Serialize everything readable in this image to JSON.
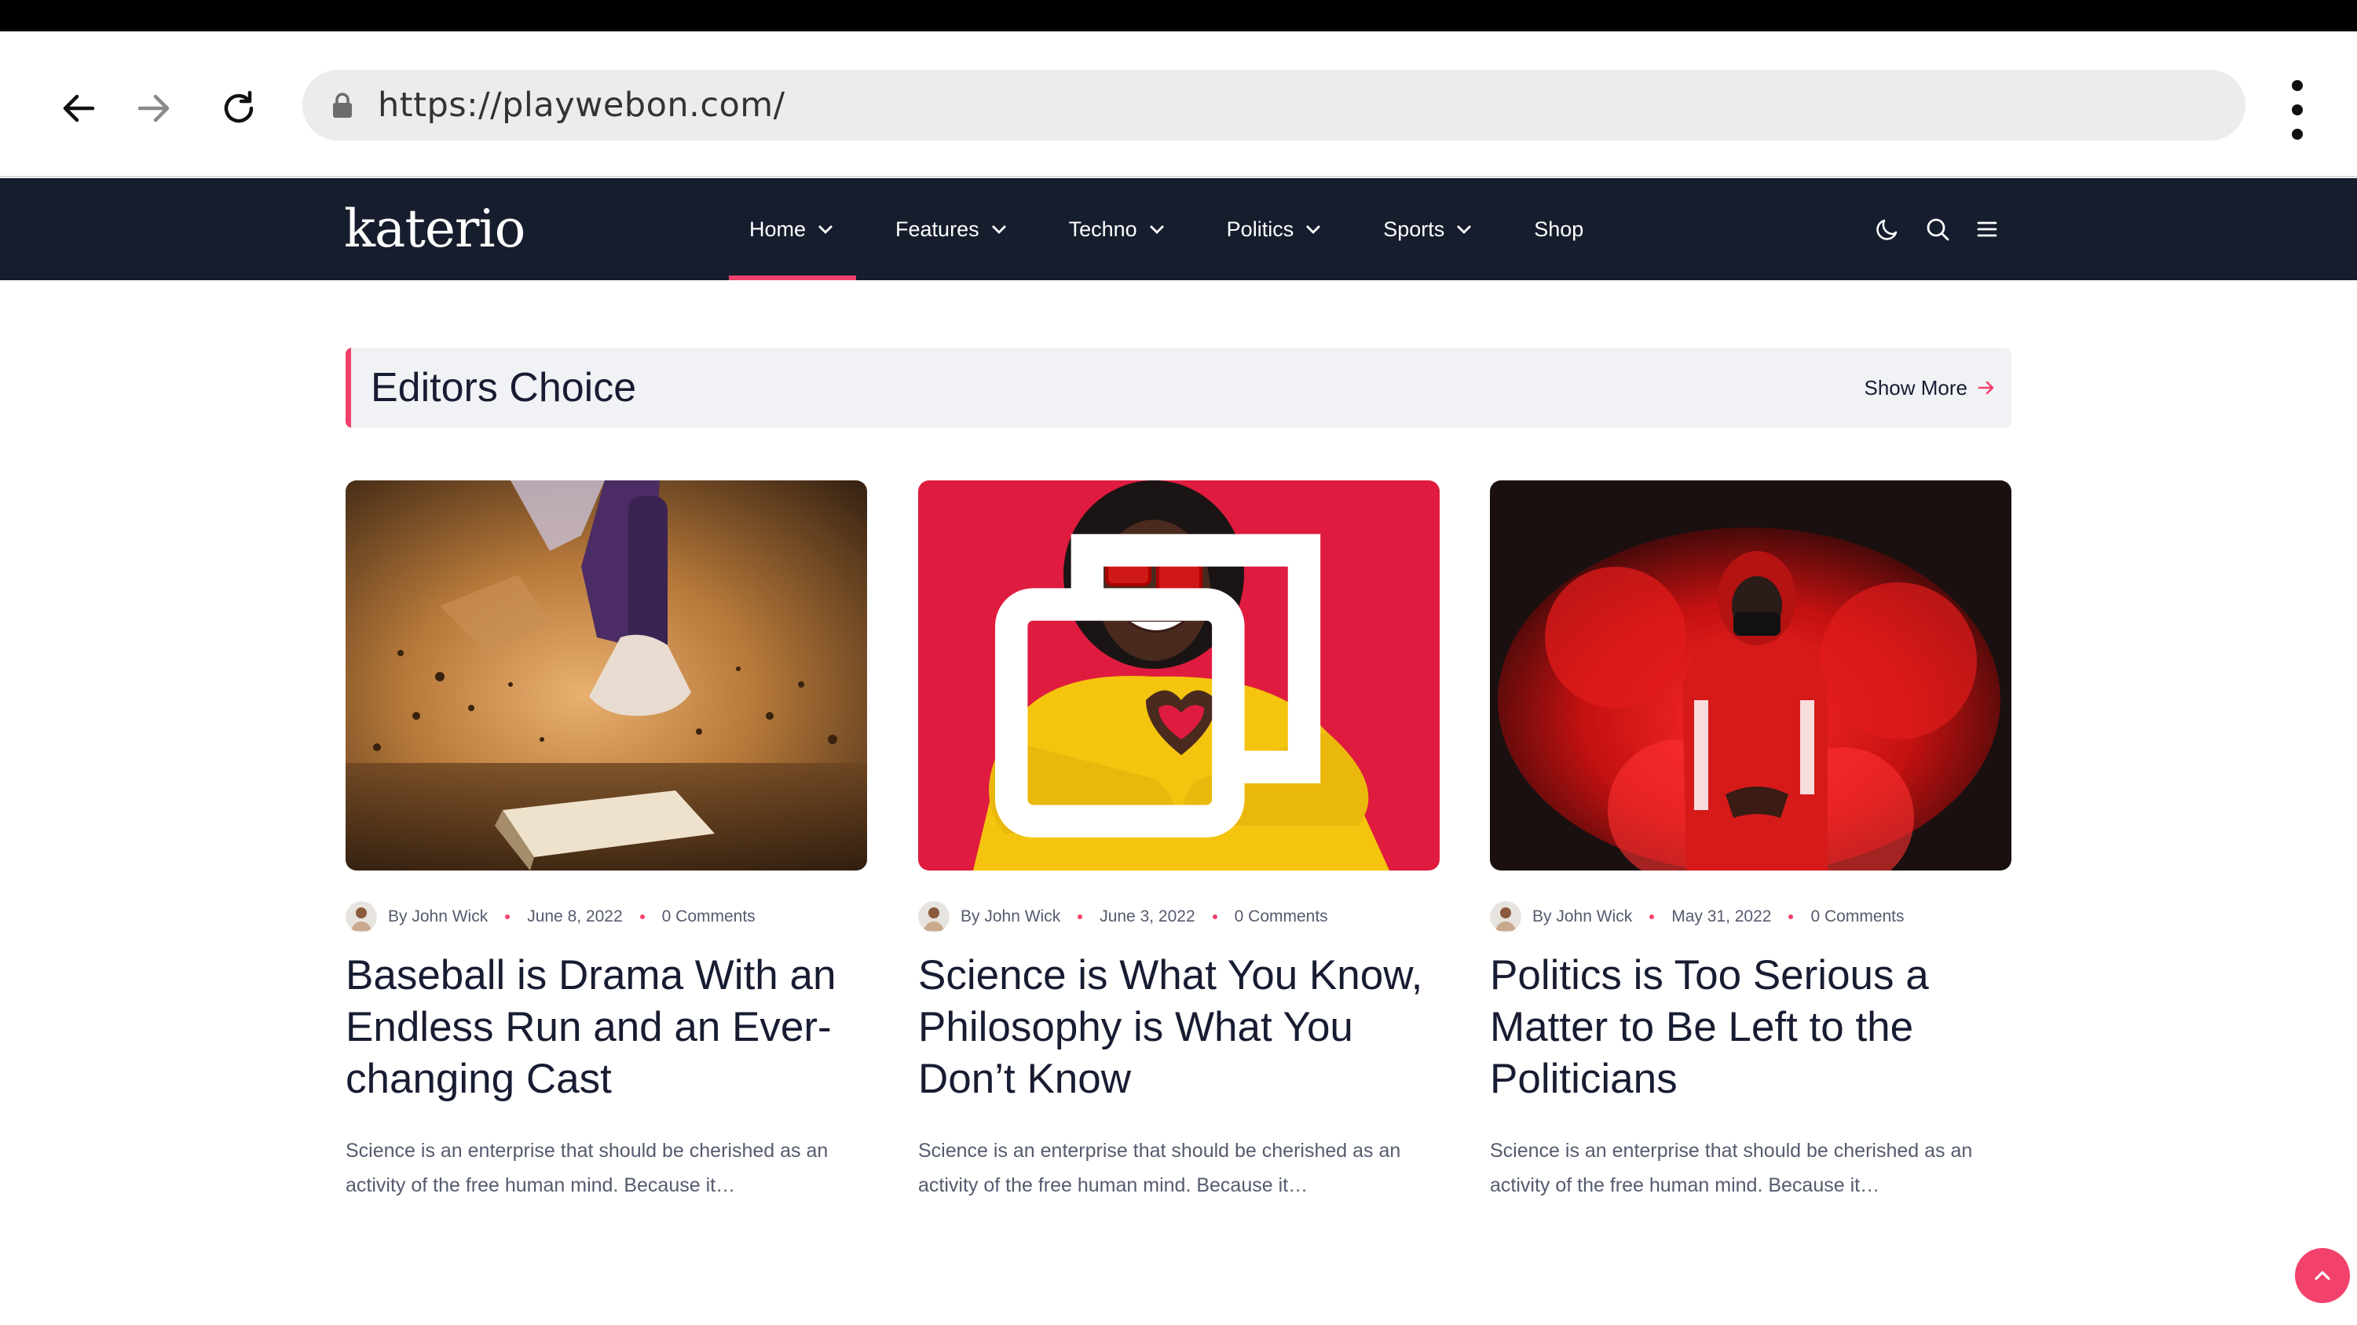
{
  "browser": {
    "url": "https://playwebon.com/",
    "back_icon": "arrow-left-icon",
    "forward_icon": "arrow-right-icon",
    "reload_icon": "reload-icon",
    "lock_icon": "lock-icon",
    "menu_icon": "more-vertical-icon"
  },
  "site": {
    "logo": "katerio",
    "nav": [
      {
        "label": "Home",
        "has_dropdown": true,
        "active": true
      },
      {
        "label": "Features",
        "has_dropdown": true
      },
      {
        "label": "Techno",
        "has_dropdown": true
      },
      {
        "label": "Politics",
        "has_dropdown": true
      },
      {
        "label": "Sports",
        "has_dropdown": true
      },
      {
        "label": "Shop",
        "has_dropdown": false
      }
    ],
    "header_icons": [
      "moon-icon",
      "search-icon",
      "hamburger-menu-icon"
    ]
  },
  "section": {
    "title": "Editors Choice",
    "show_more": "Show More"
  },
  "posts": [
    {
      "author": "By John Wick",
      "date": "June 8, 2022",
      "comments": "0 Comments",
      "title": "Baseball is Drama With an Endless Run and an Ever-changing Cast",
      "excerpt": "Science is an enterprise that should be cherished as an activity of the free human mind. Because it…",
      "gallery": false
    },
    {
      "author": "By John Wick",
      "date": "June 3, 2022",
      "comments": "0 Comments",
      "title": "Science is What You Know, Philosophy is What You Don’t Know",
      "excerpt": "Science is an enterprise that should be cherished as an activity of the free human mind. Because it…",
      "gallery": true
    },
    {
      "author": "By John Wick",
      "date": "May 31, 2022",
      "comments": "0 Comments",
      "title": "Politics is Too Serious a Matter to Be Left to the Politicians",
      "excerpt": "Science is an enterprise that should be cherished as an activity of the free human mind. Because it…",
      "gallery": false
    }
  ],
  "colors": {
    "accent": "#f2416b",
    "header_bg": "#161d2d",
    "text": "#181c32",
    "muted": "#555b6e",
    "section_bg": "#f1f2f5"
  },
  "scroll_top_icon": "chevron-up-icon"
}
